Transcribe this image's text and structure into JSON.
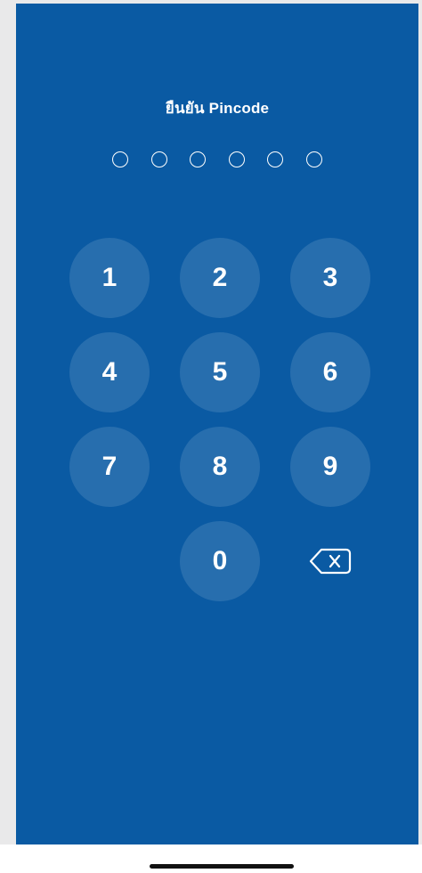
{
  "header": {
    "title": "ยืนยัน Pincode"
  },
  "pin": {
    "length": 6,
    "filled": 0
  },
  "keypad": {
    "keys": [
      "1",
      "2",
      "3",
      "4",
      "5",
      "6",
      "7",
      "8",
      "9",
      "0"
    ],
    "backspace_icon": "backspace-icon"
  },
  "colors": {
    "background": "#0a5aa3",
    "key_background": "rgba(255,255,255,0.12)",
    "text": "#ffffff"
  }
}
